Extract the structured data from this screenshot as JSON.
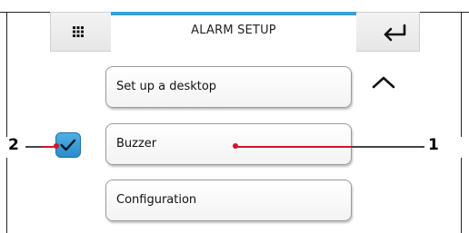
{
  "header": {
    "title": "ALARM SETUP",
    "accent_color": "#3a9fd6",
    "left_icon": "grid-menu-icon",
    "right_icon": "enter-return-icon"
  },
  "menu": {
    "items": [
      {
        "label": "Set up a desktop"
      },
      {
        "label": "Buzzer"
      },
      {
        "label": "Configuration"
      }
    ],
    "scroll_icon": "chevron-up-icon"
  },
  "checkbox": {
    "checked": true,
    "color": "#3a9fd6",
    "icon": "checkmark-icon"
  },
  "callouts": [
    {
      "number": "1",
      "color": "#d0152a"
    },
    {
      "number": "2",
      "color": "#d0152a"
    }
  ]
}
